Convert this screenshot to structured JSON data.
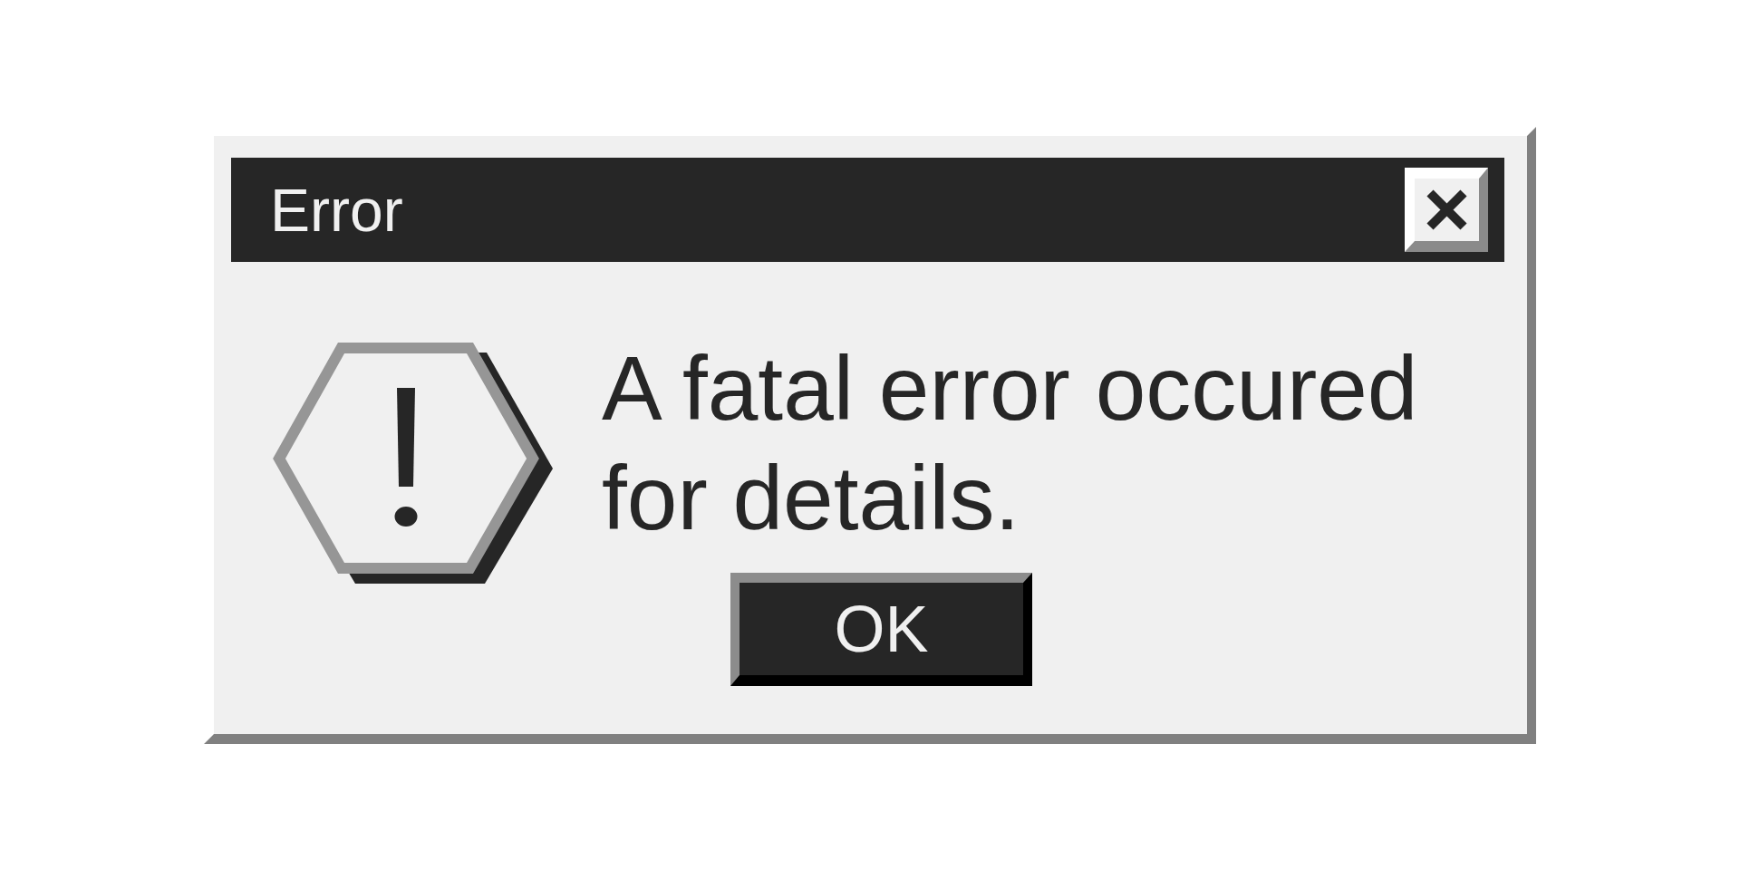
{
  "window": {
    "title": "Error"
  },
  "message": "A fatal error occured for details.",
  "buttons": [
    "OK"
  ]
}
